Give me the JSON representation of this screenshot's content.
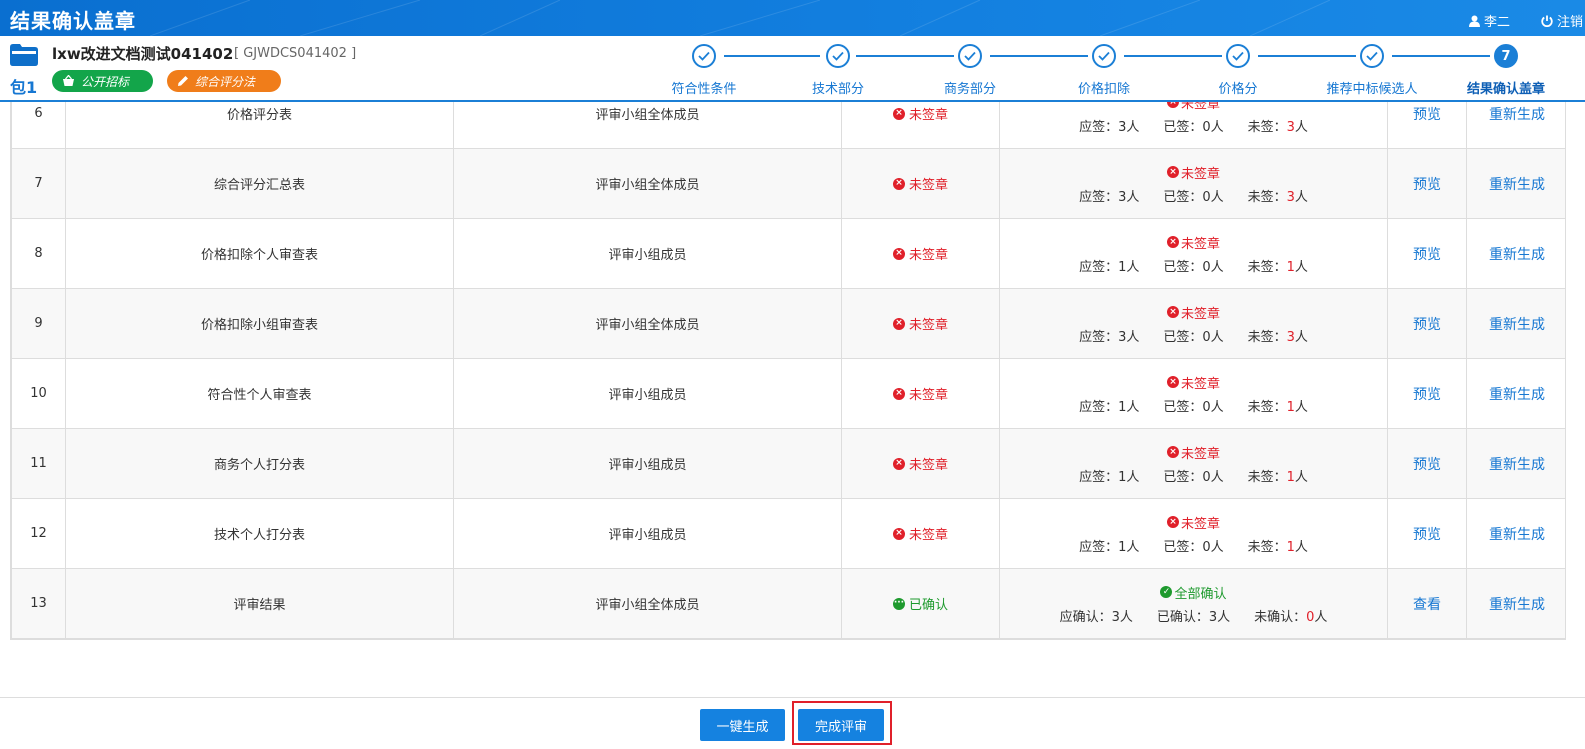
{
  "topbar": {
    "title": "结果确认盖章",
    "user": "李二",
    "logout": "注销"
  },
  "project": {
    "name": "lxw改进文档测试041402",
    "code": "[ GJWDCS041402 ]",
    "package": "包1",
    "tags": [
      "公开招标",
      "综合评分法"
    ]
  },
  "steps": [
    {
      "label": "符合性条件",
      "done": true
    },
    {
      "label": "技术部分",
      "done": true
    },
    {
      "label": "商务部分",
      "done": true
    },
    {
      "label": "价格扣除",
      "done": true
    },
    {
      "label": "价格分",
      "done": true
    },
    {
      "label": "推荐中标候选人",
      "done": true
    },
    {
      "label": "结果确认盖章",
      "done": false,
      "number": "7"
    }
  ],
  "rows": [
    {
      "no": "6",
      "name": "价格评分表",
      "signer": "评审小组全体成员",
      "status": "未签章",
      "summary": "未签章",
      "c1": "应签：3人",
      "c2": "已签：0人",
      "c3pre": "未签：",
      "c3num": "3",
      "c3suf": "人",
      "a1": "预览",
      "a2": "重新生成"
    },
    {
      "no": "7",
      "name": "综合评分汇总表",
      "signer": "评审小组全体成员",
      "status": "未签章",
      "summary": "未签章",
      "c1": "应签：3人",
      "c2": "已签：0人",
      "c3pre": "未签：",
      "c3num": "3",
      "c3suf": "人",
      "a1": "预览",
      "a2": "重新生成"
    },
    {
      "no": "8",
      "name": "价格扣除个人审查表",
      "signer": "评审小组成员",
      "status": "未签章",
      "summary": "未签章",
      "c1": "应签：1人",
      "c2": "已签：0人",
      "c3pre": "未签：",
      "c3num": "1",
      "c3suf": "人",
      "a1": "预览",
      "a2": "重新生成"
    },
    {
      "no": "9",
      "name": "价格扣除小组审查表",
      "signer": "评审小组全体成员",
      "status": "未签章",
      "summary": "未签章",
      "c1": "应签：3人",
      "c2": "已签：0人",
      "c3pre": "未签：",
      "c3num": "3",
      "c3suf": "人",
      "a1": "预览",
      "a2": "重新生成"
    },
    {
      "no": "10",
      "name": "符合性个人审查表",
      "signer": "评审小组成员",
      "status": "未签章",
      "summary": "未签章",
      "c1": "应签：1人",
      "c2": "已签：0人",
      "c3pre": "未签：",
      "c3num": "1",
      "c3suf": "人",
      "a1": "预览",
      "a2": "重新生成"
    },
    {
      "no": "11",
      "name": "商务个人打分表",
      "signer": "评审小组成员",
      "status": "未签章",
      "summary": "未签章",
      "c1": "应签：1人",
      "c2": "已签：0人",
      "c3pre": "未签：",
      "c3num": "1",
      "c3suf": "人",
      "a1": "预览",
      "a2": "重新生成"
    },
    {
      "no": "12",
      "name": "技术个人打分表",
      "signer": "评审小组成员",
      "status": "未签章",
      "summary": "未签章",
      "c1": "应签：1人",
      "c2": "已签：0人",
      "c3pre": "未签：",
      "c3num": "1",
      "c3suf": "人",
      "a1": "预览",
      "a2": "重新生成"
    },
    {
      "no": "13",
      "name": "评审结果",
      "signer": "评审小组全体成员",
      "status": "已确认",
      "confirmed": true,
      "summary": "全部确认",
      "c1": "应确认：3人",
      "c2": "已确认：3人",
      "c3pre": "未确认：",
      "c3num": "0",
      "c3suf": "人",
      "a1": "查看",
      "a2": "重新生成"
    }
  ],
  "footer": {
    "generate": "一键生成",
    "finish": "完成评审"
  },
  "colors": {
    "primary": "#1582e0",
    "danger": "#e0202a",
    "success": "#1e9a2e",
    "tag_green": "#13a54a",
    "tag_orange": "#f07d1a"
  }
}
